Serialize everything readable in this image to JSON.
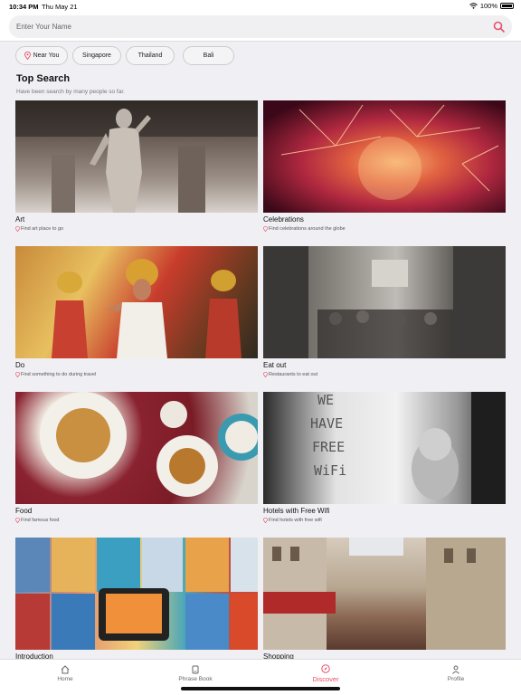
{
  "status_bar": {
    "time": "10:34 PM",
    "date": "Thu May 21",
    "battery": "100%"
  },
  "search": {
    "placeholder": "Enter Your Name"
  },
  "chips": [
    "Near You",
    "Singapore",
    "Thailand",
    "Bali"
  ],
  "section": {
    "title": "Top Search",
    "subtitle": "Have been search by many people so far."
  },
  "cards": [
    {
      "name": "Art",
      "sub": "Find art place to go"
    },
    {
      "name": "Celebrations",
      "sub": "Find celebrations around the globe"
    },
    {
      "name": "Do",
      "sub": "Find something to do during travel"
    },
    {
      "name": "Eat out",
      "sub": "Restaurants to eat out"
    },
    {
      "name": "Food",
      "sub": "Find famous food"
    },
    {
      "name": "Hotels with Free Wifi",
      "sub": "Find hotels with free wifi"
    },
    {
      "name": "Introduction",
      "sub": ""
    },
    {
      "name": "Shopping",
      "sub": ""
    }
  ],
  "hotel_sign": {
    "line1": "WE",
    "line2": "HAVE",
    "line3": "FREE",
    "line4": "WiFi"
  },
  "tabs": [
    {
      "label": "Home",
      "icon": "home-icon"
    },
    {
      "label": "Phrase Book",
      "icon": "book-icon"
    },
    {
      "label": "Discover",
      "icon": "compass-icon",
      "active": true
    },
    {
      "label": "Profile",
      "icon": "person-icon"
    }
  ],
  "colors": {
    "accent": "#e8506a",
    "background": "#f0f0f4"
  }
}
